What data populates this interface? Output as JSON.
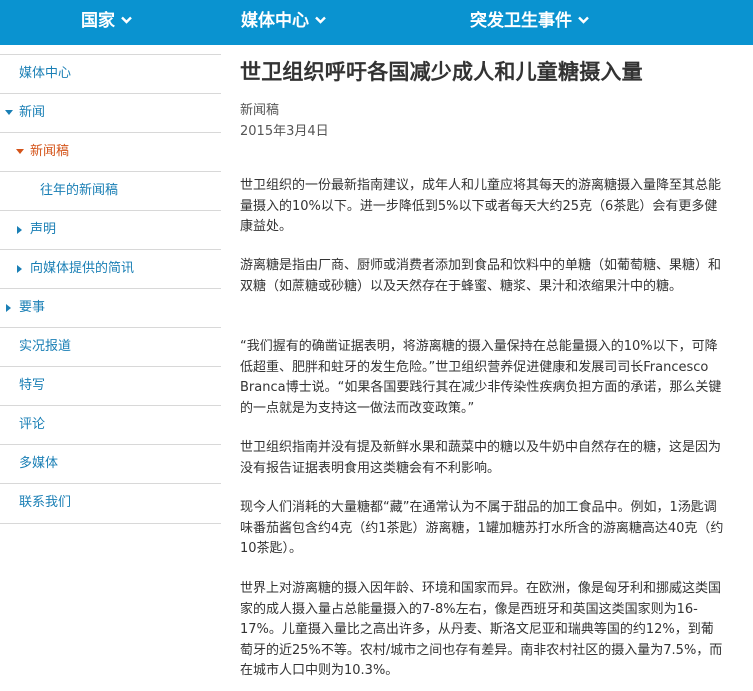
{
  "colors": {
    "topbar": "#0a93d0",
    "link": "#1a7fb5",
    "active": "#d4541a"
  },
  "topnav": [
    {
      "label": "国家",
      "icon": "chevron-down-icon"
    },
    {
      "label": "媒体中心",
      "icon": "chevron-down-icon"
    },
    {
      "label": "突发卫生事件",
      "icon": "chevron-down-icon"
    }
  ],
  "sidebar": {
    "items": [
      {
        "label": "媒体中心"
      },
      {
        "label": "新闻",
        "icon": "triangle-down-icon"
      },
      {
        "label": "新闻稿",
        "icon": "triangle-down-icon"
      },
      {
        "label": "往年的新闻稿"
      },
      {
        "label": "声明",
        "icon": "triangle-right-icon"
      },
      {
        "label": "向媒体提供的简讯",
        "icon": "triangle-right-icon"
      },
      {
        "label": "要事",
        "icon": "triangle-right-icon"
      },
      {
        "label": "实况报道"
      },
      {
        "label": "特写"
      },
      {
        "label": "评论"
      },
      {
        "label": "多媒体"
      },
      {
        "label": "联系我们"
      }
    ]
  },
  "article": {
    "title": "世卫组织呼吁各国减少成人和儿童糖摄入量",
    "category": "新闻稿",
    "date": "2015年3月4日",
    "paragraphs": [
      "世卫组织的一份最新指南建议，成年人和儿童应将其每天的游离糖摄入量降至其总能量摄入的10%以下。进一步降低到5%以下或者每天大约25克（6茶匙）会有更多健康益处。",
      "游离糖是指由厂商、厨师或消费者添加到食品和饮料中的单糖（如葡萄糖、果糖）和双糖（如蔗糖或砂糖）以及天然存在于蜂蜜、糖浆、果汁和浓缩果汁中的糖。",
      "“我们握有的确凿证据表明，将游离糖的摄入量保持在总能量摄入的10%以下，可降低超重、肥胖和蛀牙的发生危险。”世卫组织营养促进健康和发展司司长Francesco Branca博士说。“如果各国要践行其在减少非传染性疾病负担方面的承诺，那么关键的一点就是为支持这一做法而改变政策。”",
      "世卫组织指南并没有提及新鲜水果和蔬菜中的糖以及牛奶中自然存在的糖，这是因为没有报告证据表明食用这类糖会有不利影响。",
      "现今人们消耗的大量糖都“藏”在通常认为不属于甜品的加工食品中。例如，1汤匙调味番茄酱包含约4克（约1茶匙）游离糖，1罐加糖苏打水所含的游离糖高达40克（约10茶匙）。",
      "世界上对游离糖的摄入因年龄、环境和国家而异。在欧洲，像是匈牙利和挪威这类国家的成人摄入量占总能量摄入的7-8%左右，像是西班牙和英国这类国家则为16-17%。儿童摄入量比之高出许多，从丹麦、斯洛文尼亚和瑞典等国的约12%，到葡萄牙的近25%不等。农村/城市之间也存有差异。南非农村社区的摄入量为7.5%，而在城市人口中则为10.3%。"
    ]
  }
}
